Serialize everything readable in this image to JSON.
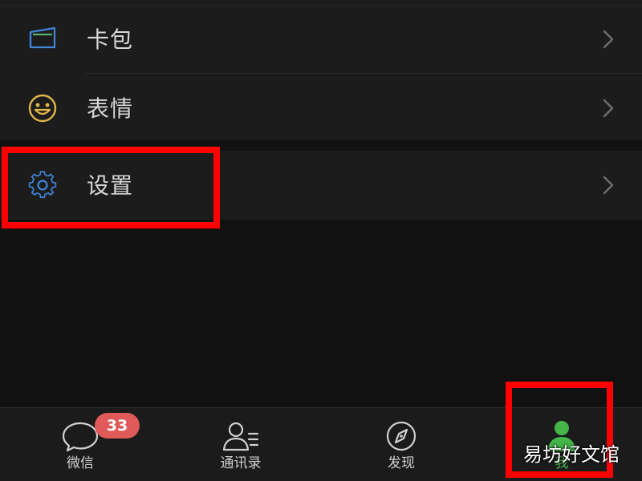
{
  "menu": {
    "items": [
      {
        "label": "卡包",
        "icon": "card-wallet-icon",
        "color": "#3f86d9"
      },
      {
        "label": "表情",
        "icon": "smiley-icon",
        "color": "#e0b64a"
      },
      {
        "label": "设置",
        "icon": "gear-icon",
        "color": "#3f86d9"
      }
    ]
  },
  "tabbar": {
    "tabs": [
      {
        "label": "微信",
        "icon": "chat-bubble-icon",
        "badge": "33"
      },
      {
        "label": "通讯录",
        "icon": "contacts-icon"
      },
      {
        "label": "发现",
        "icon": "compass-icon"
      },
      {
        "label": "我",
        "icon": "person-icon"
      }
    ],
    "active_color": "#44b549",
    "badge_color": "#e05a5a"
  },
  "annotations": {
    "highlight_color": "#ff0000"
  },
  "watermark": {
    "text": "易坊好文馆"
  }
}
